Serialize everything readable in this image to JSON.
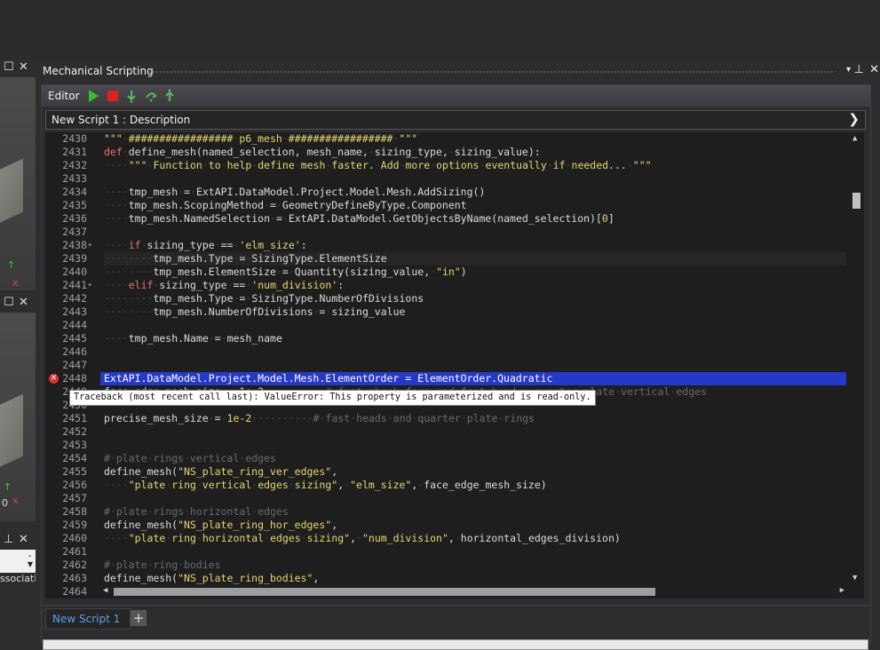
{
  "window": {
    "title": "Mechanical Scripting",
    "pin_label": "▾",
    "pin2_label": "⊥",
    "close_label": "✕"
  },
  "left_panels": {
    "maximize_label": "☐",
    "close_label": "✕",
    "pin_label": "⊥",
    "truncated_text": "ssociatio",
    "zero_label": "0"
  },
  "editor": {
    "label": "Editor",
    "description": "New Script 1 : Description",
    "expand_label": "❯"
  },
  "tooltip": "Traceback (most recent call last): ValueError: This property is parameterized and is read-only.",
  "code_lines": [
    {
      "n": "2430",
      "text": "\"\"\" ################# p6_mesh ################# \"\"\""
    },
    {
      "n": "2431",
      "text": "def define_mesh(named_selection, mesh_name, sizing_type, sizing_value):"
    },
    {
      "n": "2432",
      "text": "    \"\"\" Function to help define mesh faster. Add more options eventually if needed... \"\"\""
    },
    {
      "n": "2433",
      "text": ""
    },
    {
      "n": "2434",
      "text": "    tmp_mesh = ExtAPI.DataModel.Project.Model.Mesh.AddSizing()"
    },
    {
      "n": "2435",
      "text": "    tmp_mesh.ScopingMethod = GeometryDefineByType.Component"
    },
    {
      "n": "2436",
      "text": "    tmp_mesh.NamedSelection = ExtAPI.DataModel.GetObjectsByName(named_selection)[0]"
    },
    {
      "n": "2437",
      "text": ""
    },
    {
      "n": "2438",
      "text": "    if sizing_type == 'elm_size':"
    },
    {
      "n": "2439",
      "text": "        tmp_mesh.Type = SizingType.ElementSize"
    },
    {
      "n": "2440",
      "text": "        tmp_mesh.ElementSize = Quantity(sizing_value, \"in\")"
    },
    {
      "n": "2441",
      "text": "    elif sizing_type == 'num_division':"
    },
    {
      "n": "2442",
      "text": "        tmp_mesh.Type = SizingType.NumberOfDivisions"
    },
    {
      "n": "2443",
      "text": "        tmp_mesh.NumberOfDivisions = sizing_value"
    },
    {
      "n": "2444",
      "text": ""
    },
    {
      "n": "2445",
      "text": "    tmp_mesh.Name = mesh_name"
    },
    {
      "n": "2446",
      "text": ""
    },
    {
      "n": "2447",
      "text": ""
    },
    {
      "n": "2448",
      "text": "ExtAPI.DataModel.Project.Model.Mesh.ElementOrder = ElementOrder.Quadratic"
    },
    {
      "n": "2449",
      "text": "face_edge_mesh_size = 1e-2          # fast check face and fast head + quarter plate vertical edges"
    },
    {
      "n": "2450",
      "text": ""
    },
    {
      "n": "2451",
      "text": "precise_mesh_size = 1e-2          # fast heads and quarter plate rings"
    },
    {
      "n": "2452",
      "text": ""
    },
    {
      "n": "2453",
      "text": ""
    },
    {
      "n": "2454",
      "text": "# plate rings vertical edges"
    },
    {
      "n": "2455",
      "text": "define_mesh(\"NS_plate_ring_ver_edges\","
    },
    {
      "n": "2456",
      "text": "    \"plate ring vertical edges sizing\", \"elm_size\", face_edge_mesh_size)"
    },
    {
      "n": "2457",
      "text": ""
    },
    {
      "n": "2458",
      "text": "# plate rings horizontal edges"
    },
    {
      "n": "2459",
      "text": "define_mesh(\"NS_plate_ring_hor_edges\","
    },
    {
      "n": "2460",
      "text": "    \"plate ring horizontal edges sizing\", \"num_division\", horizontal_edges_division)"
    },
    {
      "n": "2461",
      "text": ""
    },
    {
      "n": "2462",
      "text": "# plate ring bodies"
    },
    {
      "n": "2463",
      "text": "define_mesh(\"NS_plate_ring_bodies\","
    },
    {
      "n": "2464",
      "text": ""
    }
  ],
  "tabs": {
    "active": "New Script 1",
    "add_label": "+"
  },
  "colors": {
    "selection": "#2638c8",
    "keyword": "#f07070",
    "string": "#e5d66e",
    "comment": "#6a6a6a",
    "tab_text": "#5aa0e6"
  }
}
